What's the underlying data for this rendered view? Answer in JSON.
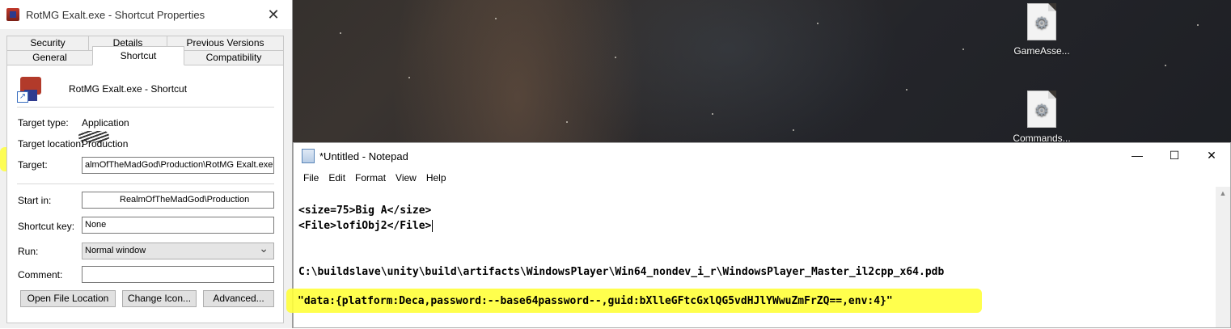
{
  "desktop": {
    "icons": [
      {
        "label": "GameAsse...",
        "icon": "file-settings-icon"
      },
      {
        "label": "Commands...",
        "icon": "file-settings-icon"
      }
    ]
  },
  "properties_dialog": {
    "title": "RotMG Exalt.exe - Shortcut Properties",
    "tabs_row1": [
      "Security",
      "Details",
      "Previous Versions"
    ],
    "tabs_row2": [
      "General",
      "Shortcut",
      "Compatibility"
    ],
    "active_tab": "Shortcut",
    "shortcut_name": "RotMG Exalt.exe - Shortcut",
    "target_type_label": "Target type:",
    "target_type_value": "Application",
    "target_location_label": "Target location:",
    "target_location_value": "Production",
    "target_label": "Target:",
    "target_value": "almOfTheMadGod\\Production\\RotMG Exalt.exe\"",
    "start_in_label": "Start in:",
    "start_in_value": "RealmOfTheMadGod\\Production",
    "shortcut_key_label": "Shortcut key:",
    "shortcut_key_value": "None",
    "run_label": "Run:",
    "run_value": "Normal window",
    "comment_label": "Comment:",
    "comment_value": "",
    "buttons": {
      "open_file_location": "Open File Location",
      "change_icon": "Change Icon...",
      "advanced": "Advanced..."
    },
    "highlight_color": "#ffff3a"
  },
  "notepad": {
    "title": "*Untitled - Notepad",
    "menu": [
      "File",
      "Edit",
      "Format",
      "View",
      "Help"
    ],
    "lines": {
      "line1": "<size=75>Big A</size>",
      "line2": "<File>lofiObj2</File>",
      "line3": "C:\\buildslave\\unity\\build\\artifacts\\WindowsPlayer\\Win64_nondev_i_r\\WindowsPlayer_Master_il2cpp_x64.pdb",
      "line4": "\"data:{platform:Deca,password:--base64password--,guid:bXlleGFtcGxlQG5vdHJlYWwuZmFrZQ==,env:4}\""
    },
    "highlight_color": "#ffff3a"
  }
}
